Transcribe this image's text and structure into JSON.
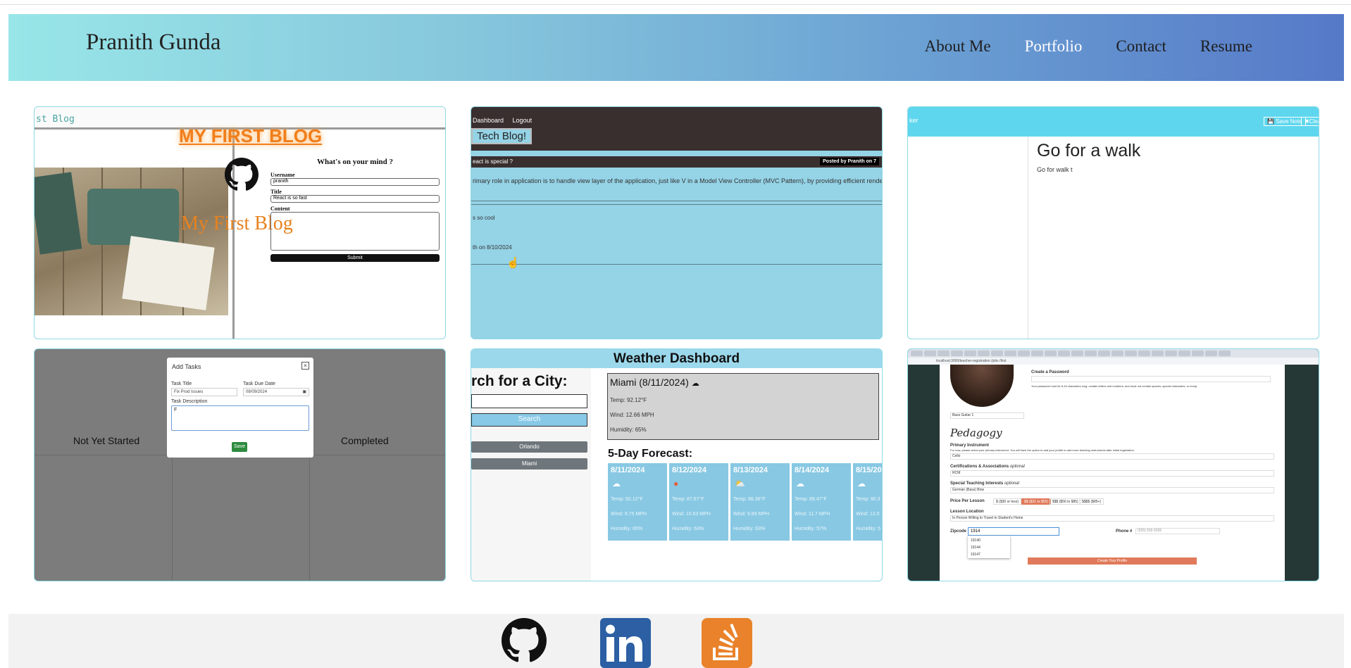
{
  "header": {
    "brand": "Pranith Gunda",
    "nav": [
      "About Me",
      "Portfolio",
      "Contact",
      "Resume"
    ],
    "active_nav": "Portfolio",
    "gradient": [
      "#98e6e8",
      "#5679c8"
    ]
  },
  "projects": {
    "blog": {
      "topbar": "st Blog",
      "big_title": "MY FIRST BLOG",
      "name": "My First Blog",
      "form_heading": "What's on your mind ?",
      "username_label": "Username",
      "username_value": "pranith",
      "title_label": "Title",
      "title_value": "React is so fast",
      "content_label": "Content",
      "submit": "Submit",
      "accent": "#e8821e"
    },
    "tech_blog": {
      "links": [
        "Dashboard",
        "Logout"
      ],
      "title": "Tech Blog!",
      "post_title": "eact is special ?",
      "posted": "Posted by Pranith on 7",
      "paragraph": "rimary role in application is to handle view layer of the application, just like V in a Model View Controller (MVC Pattern), by providing efficient rendering. React",
      "comment": "s so cool",
      "comment_meta": "th on 8/10/2024"
    },
    "note_taker": {
      "left_text": "ker",
      "save": "Save Note",
      "clear": "Clea",
      "note_title": "Go for a walk",
      "note_text": "Go for walk t"
    },
    "task_board": {
      "columns": [
        "Not Yet Started",
        "Completed"
      ],
      "modal_title": "Add Tasks",
      "close": "×",
      "task_title_label": "Task Title",
      "task_title_value": "Fix Prod Issues",
      "due_label": "Task Due Date",
      "due_value": "08/09/2024",
      "desc_label": "Task Description",
      "desc_value": "F",
      "save": "Save"
    },
    "weather": {
      "title": "Weather Dashboard",
      "search_heading": "rch for a City:",
      "search_button": "Search",
      "cities": [
        "Orlando",
        "Miami"
      ],
      "current": {
        "city": "Miami (8/11/2024)",
        "temp": "Temp: 92.12°F",
        "wind": "Wind: 12.66 MPH",
        "humidity": "Humidity: 65%"
      },
      "forecast_heading": "5-Day Forecast:",
      "forecast": [
        {
          "date": "8/11/2024",
          "temp": "Temp: 92.12°F",
          "wind": "Wind: 9.75 MPH",
          "humidity": "Humidity: 65%"
        },
        {
          "date": "8/12/2024",
          "temp": "Temp: 87.67°F",
          "wind": "Wind: 10.63 MPH",
          "humidity": "Humidity: 63%"
        },
        {
          "date": "8/13/2024",
          "temp": "Temp: 88.36°F",
          "wind": "Wind: 9.89 MPH",
          "humidity": "Humidity: 63%"
        },
        {
          "date": "8/14/2024",
          "temp": "Temp: 89.47°F",
          "wind": "Wind: 11.7 MPH",
          "humidity": "Humidity: 57%"
        },
        {
          "date": "8/15/202",
          "temp": "Temp: 90.3",
          "wind": "Wind: 12.0",
          "humidity": "Humidity: 5"
        }
      ]
    },
    "registration": {
      "address": "localhost:3000/teacher-registration /jobs /first",
      "password_label": "Create a Password",
      "password_hint": "Your password must be 8-16 characters long, contain letters and numbers, and must not contain spaces, special characters, or emoji.",
      "instrument_select": "Bass Guitar 1",
      "pedagogy": "Pedagogy",
      "primary_label": "Primary Instrument",
      "primary_hint": "For now, please select your primary instrument. You will have the option to add your profile to add more teaching instruments after initial registration.",
      "primary_value": "Cello",
      "cert_label": "Certifications & Associations",
      "cert_value": "RCM",
      "special_label": "Special Teaching Interests",
      "special_value": "German (Bass) Bow",
      "optional": "optional",
      "price_label": "Price Per Lesson",
      "prices": [
        "$ ($30 or less)",
        "$$ ($31 to $55)",
        "$$$ ($56 to $85)",
        "$$$$ ($85+)"
      ],
      "selected_price": "$$ ($31 to $55)",
      "lesson_label": "Lesson Location",
      "lesson_value": "In Person  Willing to Travel to Student's Home",
      "zip_label": "Zipcode",
      "zip_value": "1914",
      "phone_label": "Phone #",
      "phone_placeholder": "(555) 555-5555",
      "zip_options": [
        "19140",
        "19144",
        "19147"
      ],
      "create": "Create Your Profile"
    }
  },
  "footer": {
    "icons": [
      "github-icon",
      "linkedin-icon",
      "stackoverflow-icon"
    ]
  }
}
